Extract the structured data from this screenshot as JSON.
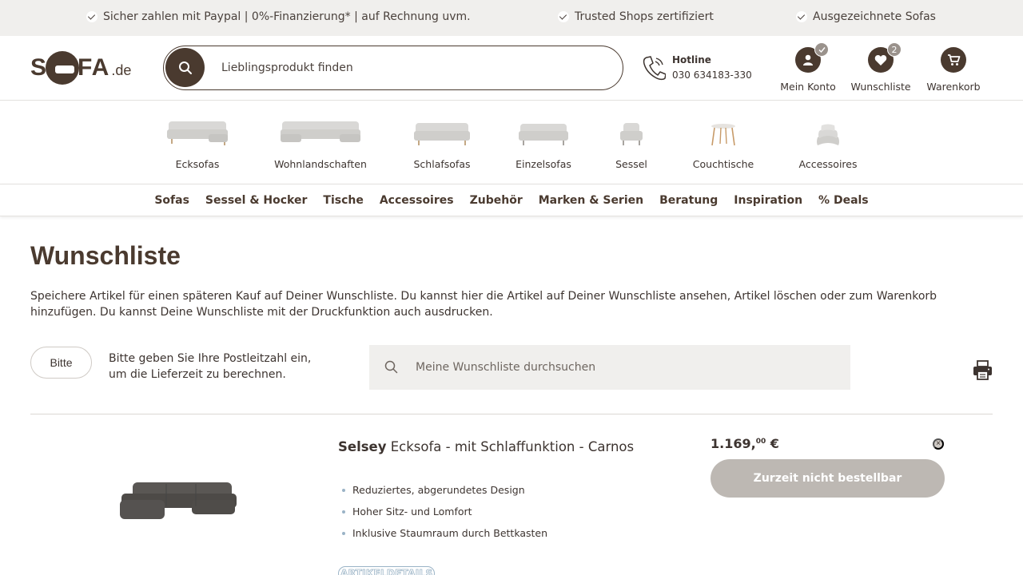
{
  "topbar": {
    "usps": [
      "Sicher zahlen mit Paypal | 0%-Finanzierung* | auf Rechnung uvm.",
      "Trusted Shops zertifiziert",
      "Ausgezeichnete Sofas"
    ]
  },
  "header": {
    "logo": {
      "part1": "S",
      "part2": "FA",
      "part3": ".de"
    },
    "search": {
      "placeholder": "Lieblingsprodukt finden"
    },
    "hotline": {
      "label": "Hotline",
      "number": "030 634183-330"
    },
    "account_label": "Mein Konto",
    "wishlist": {
      "label": "Wunschliste",
      "count": "2"
    },
    "cart_label": "Warenkorb"
  },
  "categories": [
    {
      "label": "Ecksofas",
      "icon": "corner-sofa-icon"
    },
    {
      "label": "Wohnlandschaften",
      "icon": "living-landscape-sofa-icon"
    },
    {
      "label": "Schlafsofas",
      "icon": "sleeper-sofa-icon"
    },
    {
      "label": "Einzelsofas",
      "icon": "single-sofa-icon"
    },
    {
      "label": "Sessel",
      "icon": "armchair-icon"
    },
    {
      "label": "Couchtische",
      "icon": "coffee-table-icon"
    },
    {
      "label": "Accessoires",
      "icon": "cushions-icon"
    }
  ],
  "mainnav": [
    "Sofas",
    "Sessel & Hocker",
    "Tische",
    "Accessoires",
    "Zubehör",
    "Marken & Serien",
    "Beratung",
    "Inspiration",
    "% Deals"
  ],
  "page": {
    "title": "Wunschliste",
    "intro": "Speichere Artikel für einen späteren Kauf auf Deiner Wunschliste. Du kannst hier die Artikel auf Deiner Wunschliste ansehen, Artikel löschen oder zum Warenkorb hinzufügen. Du kannst Deine Wunschliste mit der Druckfunktion auch ausdrucken.",
    "plz_button": "Bitte",
    "plz_text": "Bitte geben Sie Ihre Postleitzahl ein, um die Lieferzeit zu berechnen.",
    "wishlist_search_placeholder": "Meine Wunschliste durchsuchen"
  },
  "product": {
    "brand": "Selsey",
    "name": "Ecksofa - mit Schlaffunktion - Carnos",
    "features": [
      "Reduziertes, abgerundetes Design",
      "Hoher Sitz- und Lomfort",
      "Inklusive Staumraum durch Bettkasten"
    ],
    "details_link": "ARTIKELDETAILS",
    "price_main": "1.169,",
    "price_cents": "00",
    "currency": "€",
    "status_button": "Zurzeit nicht bestellbar",
    "remove_symbol": "×"
  },
  "colors": {
    "brand": "#4a3a2f",
    "topbar_bg": "#f0efed",
    "disabled_button": "#bdb8b3",
    "link_blue": "#9ab3c6"
  }
}
